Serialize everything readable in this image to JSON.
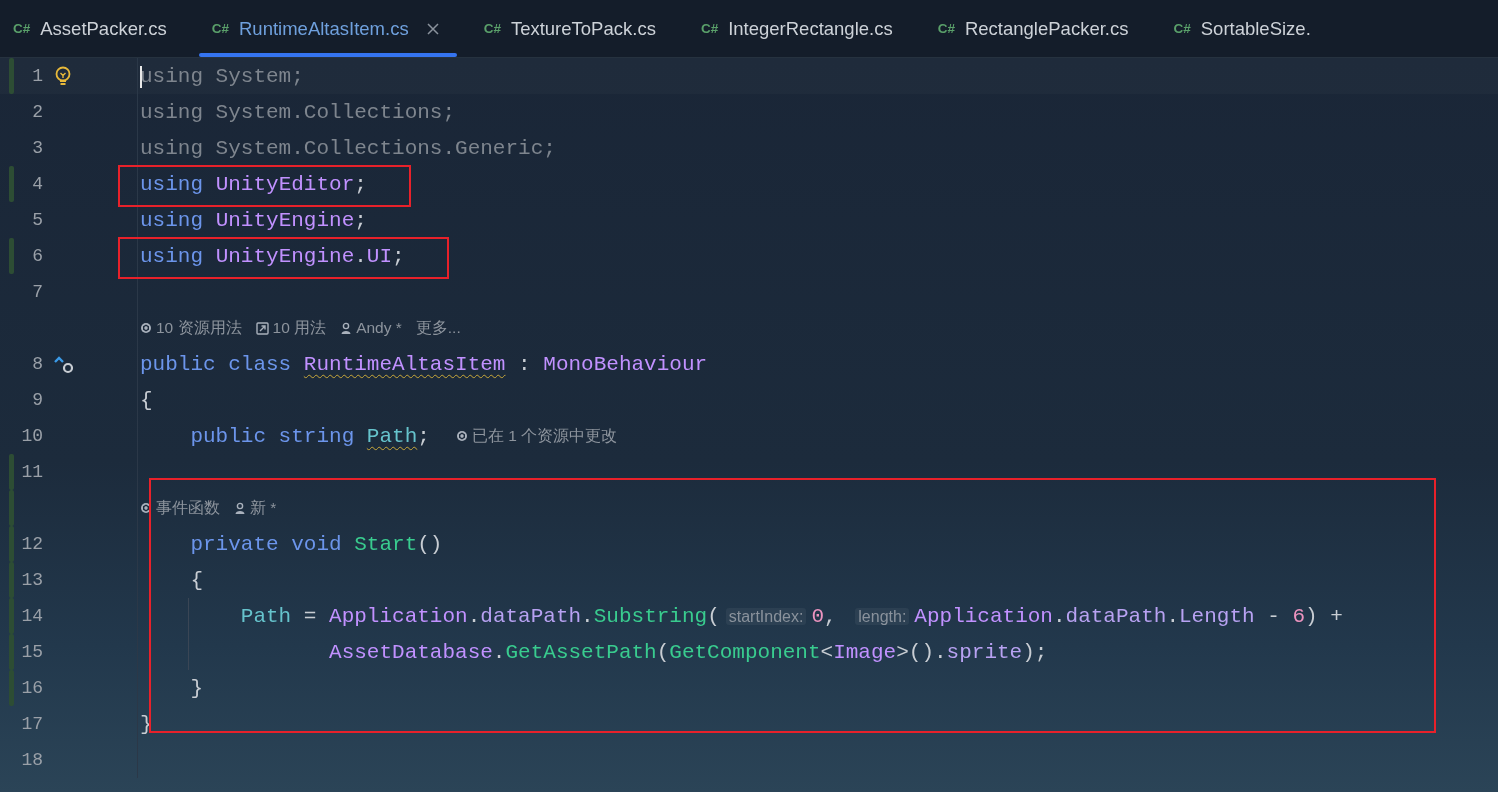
{
  "tabs": [
    {
      "icon_text": "C#",
      "label": "AssetPacker.cs",
      "selected": false,
      "closable": false
    },
    {
      "icon_text": "C#",
      "label": "RuntimeAltasItem.cs",
      "selected": true,
      "closable": true
    },
    {
      "icon_text": "C#",
      "label": "TextureToPack.cs",
      "selected": false,
      "closable": false
    },
    {
      "icon_text": "C#",
      "label": "IntegerRectangle.cs",
      "selected": false,
      "closable": false
    },
    {
      "icon_text": "C#",
      "label": "RectanglePacker.cs",
      "selected": false,
      "closable": false
    },
    {
      "icon_text": "C#",
      "label": "SortableSize.",
      "selected": false,
      "closable": false
    }
  ],
  "lines": [
    {
      "kind": "code",
      "number": "1",
      "changed": true,
      "cursor": true,
      "quick_fix": true,
      "tokens": [
        {
          "kind": "dim",
          "text": "using System;"
        }
      ]
    },
    {
      "kind": "code",
      "number": "2",
      "changed": false,
      "cursor": false,
      "tokens": [
        {
          "kind": "dim",
          "text": "using System.Collections;"
        }
      ]
    },
    {
      "kind": "code",
      "number": "3",
      "changed": false,
      "cursor": false,
      "tokens": [
        {
          "kind": "dim",
          "text": "using System.Collections.Generic;"
        }
      ]
    },
    {
      "kind": "code",
      "number": "4",
      "changed": true,
      "cursor": false,
      "box_start": true,
      "box_end": true,
      "tokens": [
        {
          "kind": "kw",
          "text": "using "
        },
        {
          "kind": "type",
          "text": "UnityEditor"
        },
        {
          "kind": "plain",
          "text": ";"
        }
      ]
    },
    {
      "kind": "code",
      "number": "5",
      "changed": false,
      "cursor": false,
      "tokens": [
        {
          "kind": "kw",
          "text": "using "
        },
        {
          "kind": "type",
          "text": "UnityEngine"
        },
        {
          "kind": "plain",
          "text": ";"
        }
      ]
    },
    {
      "kind": "code",
      "number": "6",
      "changed": true,
      "cursor": false,
      "box_start": true,
      "box_end": true,
      "tokens": [
        {
          "kind": "kw",
          "text": "using "
        },
        {
          "kind": "type",
          "text": "UnityEngine"
        },
        {
          "kind": "plain",
          "text": "."
        },
        {
          "kind": "type",
          "text": "UI"
        },
        {
          "kind": "plain",
          "text": ";"
        }
      ]
    },
    {
      "kind": "code",
      "number": "7",
      "changed": false,
      "cursor": false
    },
    {
      "kind": "lens",
      "changed": false,
      "lens": [
        {
          "kind": "asset",
          "text": "10 资源用法"
        },
        {
          "kind": "usages",
          "text": "10 用法"
        },
        {
          "kind": "author",
          "text": "Andy *"
        },
        {
          "kind": "more",
          "text": "更多..."
        }
      ]
    },
    {
      "kind": "code",
      "number": "8",
      "changed": false,
      "cursor": false,
      "overrides": true,
      "tokens": [
        {
          "kind": "kw",
          "text": "public class "
        },
        {
          "kind": "type",
          "text": "RuntimeAltasItem",
          "warning": true
        },
        {
          "kind": "plain",
          "text": " : "
        },
        {
          "kind": "type",
          "text": "MonoBehaviour"
        }
      ]
    },
    {
      "kind": "code",
      "number": "9",
      "changed": false,
      "cursor": false,
      "tokens": [
        {
          "kind": "plain",
          "text": "{"
        }
      ]
    },
    {
      "kind": "code",
      "number": "10",
      "changed": false,
      "cursor": false,
      "tokens": [
        {
          "kind": "kw",
          "text": "    public string "
        },
        {
          "kind": "field",
          "text": "Path",
          "warning": true
        },
        {
          "kind": "plain",
          "text": ";"
        }
      ],
      "lens": [
        {
          "kind": "asset",
          "text": "已在 1 个资源中更改"
        }
      ]
    },
    {
      "kind": "code",
      "number": "11",
      "changed": true,
      "cursor": false
    },
    {
      "kind": "lens",
      "changed": true,
      "box_start": true,
      "lens": [
        {
          "kind": "asset",
          "text": "事件函数"
        },
        {
          "kind": "author",
          "text": "新 *"
        }
      ]
    },
    {
      "kind": "code",
      "number": "12",
      "changed": true,
      "cursor": false,
      "tokens": [
        {
          "kind": "kw",
          "text": "    private void "
        },
        {
          "kind": "method",
          "text": "Start"
        },
        {
          "kind": "plain",
          "text": "()"
        }
      ]
    },
    {
      "kind": "code",
      "number": "13",
      "changed": true,
      "cursor": false,
      "tokens": [
        {
          "kind": "plain",
          "text": "    {"
        }
      ]
    },
    {
      "kind": "code",
      "number": "14",
      "changed": true,
      "cursor": false,
      "indent_guide": true,
      "tokens": [
        {
          "kind": "field",
          "text": "        Path"
        },
        {
          "kind": "plain",
          "text": " = "
        },
        {
          "kind": "type",
          "text": "Application"
        },
        {
          "kind": "plain",
          "text": "."
        },
        {
          "kind": "prop",
          "text": "dataPath"
        },
        {
          "kind": "plain",
          "text": "."
        },
        {
          "kind": "method",
          "text": "Substring"
        },
        {
          "kind": "plain",
          "text": "("
        },
        {
          "kind": "hint",
          "text": "startIndex:"
        },
        {
          "kind": "num",
          "text": "0"
        },
        {
          "kind": "plain",
          "text": ", "
        },
        {
          "kind": "hint",
          "text": "length:"
        },
        {
          "kind": "type",
          "text": "Application"
        },
        {
          "kind": "plain",
          "text": "."
        },
        {
          "kind": "prop",
          "text": "dataPath"
        },
        {
          "kind": "plain",
          "text": "."
        },
        {
          "kind": "prop",
          "text": "Length"
        },
        {
          "kind": "plain",
          "text": " - "
        },
        {
          "kind": "num",
          "text": "6"
        },
        {
          "kind": "plain",
          "text": ") +"
        }
      ]
    },
    {
      "kind": "code",
      "number": "15",
      "changed": true,
      "cursor": false,
      "indent_guide": true,
      "tokens": [
        {
          "kind": "type",
          "text": "               AssetDatabase"
        },
        {
          "kind": "plain",
          "text": "."
        },
        {
          "kind": "method",
          "text": "GetAssetPath"
        },
        {
          "kind": "plain",
          "text": "("
        },
        {
          "kind": "method",
          "text": "GetComponent"
        },
        {
          "kind": "plain",
          "text": "<"
        },
        {
          "kind": "type",
          "text": "Image"
        },
        {
          "kind": "plain",
          "text": ">()."
        },
        {
          "kind": "prop",
          "text": "sprite"
        },
        {
          "kind": "plain",
          "text": ");"
        }
      ]
    },
    {
      "kind": "code",
      "number": "16",
      "changed": true,
      "cursor": false,
      "tokens": [
        {
          "kind": "plain",
          "text": "    }"
        }
      ]
    },
    {
      "kind": "code",
      "number": "17",
      "changed": false,
      "cursor": false,
      "box_end": true,
      "tokens": [
        {
          "kind": "plain",
          "text": "}"
        }
      ]
    },
    {
      "kind": "code",
      "number": "18",
      "changed": false,
      "cursor": false
    }
  ]
}
